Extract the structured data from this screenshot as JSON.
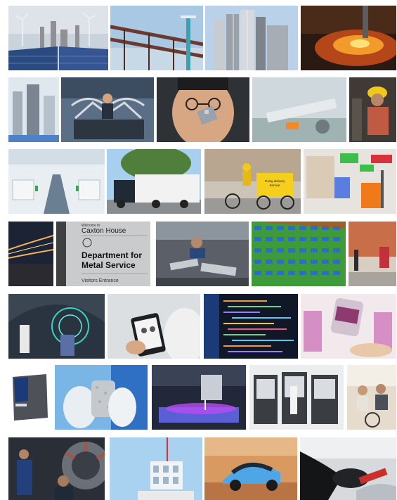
{
  "signage": {
    "building_top": "Welcome to",
    "building_name": "Caxton House",
    "department": "Department for",
    "department2": "Metal Service",
    "entrance": "Visitors Entrance"
  },
  "delivery_box": {
    "line1": "Fixing delivery",
    "line2": "Service"
  },
  "colors": {
    "sky": "#9ec4e6",
    "steel": "#8a8f96",
    "molten": "#f29b2a",
    "cargo_green": "#3bbf4a",
    "cargo_red": "#d8313a",
    "highlight_yellow": "#f2c81a",
    "building_green": "#3f9b3a",
    "code_blue": "#1b3b78"
  }
}
